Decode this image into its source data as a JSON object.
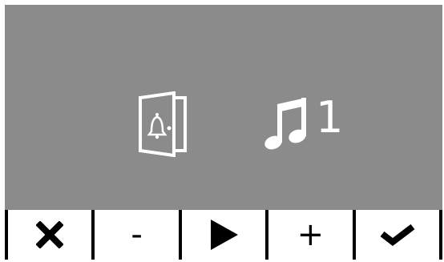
{
  "screen": {
    "background_color": "#8b8b8b",
    "door_icon": "door-bell-icon",
    "melody_icon": "music-note-icon",
    "melody_number": "1"
  },
  "softkeys": [
    {
      "icon": "close-icon",
      "label": ""
    },
    {
      "icon": "minus-icon",
      "label": "-"
    },
    {
      "icon": "play-icon",
      "label": ""
    },
    {
      "icon": "plus-icon",
      "label": "+"
    },
    {
      "icon": "check-icon",
      "label": ""
    }
  ]
}
